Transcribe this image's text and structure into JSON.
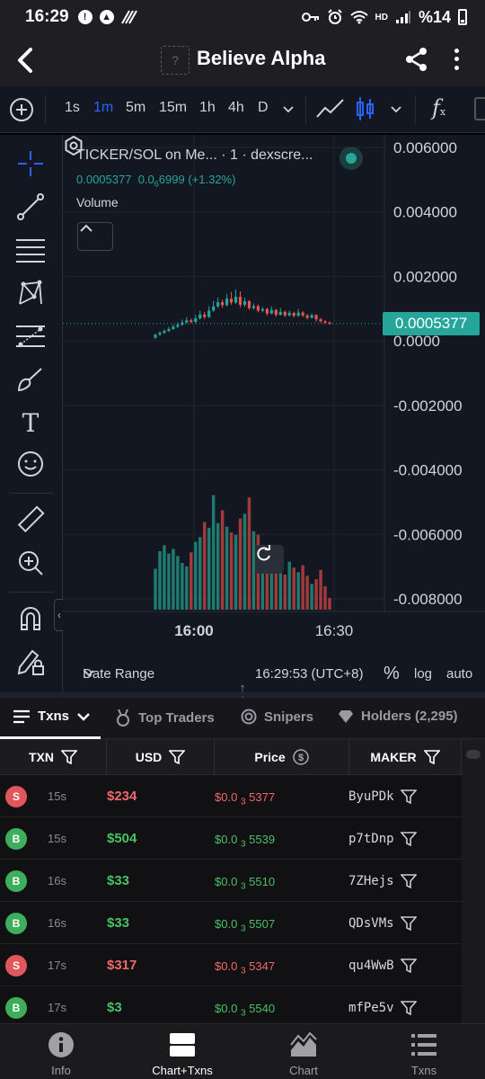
{
  "status_bar": {
    "time": "16:29",
    "network": "HD",
    "battery": "%14"
  },
  "header": {
    "title": "Believe Alpha",
    "logo_placeholder": "?"
  },
  "toolbar": {
    "intervals": [
      {
        "label": "1s",
        "active": false
      },
      {
        "label": "1m",
        "active": true
      },
      {
        "label": "5m",
        "active": false
      },
      {
        "label": "15m",
        "active": false
      },
      {
        "label": "1h",
        "active": false
      },
      {
        "label": "4h",
        "active": false
      },
      {
        "label": "D",
        "active": false
      }
    ],
    "fx_label": "f",
    "fx_sub": "x"
  },
  "drawing_tools": [
    "crosshair-icon",
    "trend-line-icon",
    "horizontal-lines-icon",
    "pattern-icon",
    "fib-icon",
    "brush-icon",
    "text-icon",
    "emoji-icon",
    "ruler-icon",
    "zoom-in-icon",
    "magnet-icon",
    "lock-pencil-icon"
  ],
  "chart": {
    "legend_title": "TICKER/SOL on Me... · 1 · dexscre...",
    "legend_price": "0.0005377",
    "legend_open": "0.0",
    "legend_open_sub": "6",
    "legend_open_rest": "6999",
    "legend_change": "(+1.32%)",
    "volume_label": "Volume",
    "last_price": "0.0005377",
    "date_range_label": "Date Range",
    "clock": "16:29:53 (UTC+8)",
    "percent_label": "%",
    "log_label": "log",
    "auto_label": "auto"
  },
  "chart_data": {
    "type": "candlestick",
    "interval": "1m",
    "y_ticks": [
      "0.006000",
      "0.004000",
      "0.002000",
      "0.0000",
      "-0.002000",
      "-0.004000",
      "-0.006000",
      "-0.008000"
    ],
    "x_ticks": [
      "16:00",
      "16:30"
    ],
    "ylim": [
      -0.0085,
      0.0065
    ],
    "last_price": 0.0005377,
    "candles": [
      {
        "o": 0.0001,
        "c": 0.00019,
        "h": 0.00023,
        "l": 7e-05
      },
      {
        "o": 0.00019,
        "c": 0.00025,
        "h": 0.0003,
        "l": 0.00016
      },
      {
        "o": 0.00025,
        "c": 0.00031,
        "h": 0.00036,
        "l": 0.00022
      },
      {
        "o": 0.00031,
        "c": 0.00037,
        "h": 0.00043,
        "l": 0.00027
      },
      {
        "o": 0.00037,
        "c": 0.00044,
        "h": 0.00051,
        "l": 0.00034
      },
      {
        "o": 0.00044,
        "c": 0.0005,
        "h": 0.00058,
        "l": 0.0004
      },
      {
        "o": 0.0005,
        "c": 0.00057,
        "h": 0.00066,
        "l": 0.00047
      },
      {
        "o": 0.00057,
        "c": 0.00064,
        "h": 0.00074,
        "l": 0.00053
      },
      {
        "o": 0.00064,
        "c": 0.00059,
        "h": 0.0007,
        "l": 0.00054
      },
      {
        "o": 0.00059,
        "c": 0.0007,
        "h": 0.00081,
        "l": 0.00055
      },
      {
        "o": 0.0007,
        "c": 0.00082,
        "h": 0.00094,
        "l": 0.00066
      },
      {
        "o": 0.00082,
        "c": 0.00074,
        "h": 0.0009,
        "l": 0.00068
      },
      {
        "o": 0.00074,
        "c": 0.00094,
        "h": 0.00108,
        "l": 0.00071
      },
      {
        "o": 0.00094,
        "c": 0.00107,
        "h": 0.00124,
        "l": 0.0009
      },
      {
        "o": 0.00107,
        "c": 0.0012,
        "h": 0.00135,
        "l": 0.00102
      },
      {
        "o": 0.0012,
        "c": 0.00111,
        "h": 0.00128,
        "l": 0.00103
      },
      {
        "o": 0.00111,
        "c": 0.00131,
        "h": 0.00146,
        "l": 0.00107
      },
      {
        "o": 0.00131,
        "c": 0.00119,
        "h": 0.00152,
        "l": 0.00112
      },
      {
        "o": 0.00119,
        "c": 0.00137,
        "h": 0.0016,
        "l": 0.00115
      },
      {
        "o": 0.00137,
        "c": 0.00112,
        "h": 0.00154,
        "l": 0.00104
      },
      {
        "o": 0.00112,
        "c": 0.00123,
        "h": 0.00134,
        "l": 0.00106
      },
      {
        "o": 0.00123,
        "c": 0.00102,
        "h": 0.00127,
        "l": 0.00096
      },
      {
        "o": 0.00102,
        "c": 0.00108,
        "h": 0.00116,
        "l": 0.00097
      },
      {
        "o": 0.00108,
        "c": 0.00094,
        "h": 0.00113,
        "l": 0.00089
      },
      {
        "o": 0.00094,
        "c": 0.00099,
        "h": 0.00105,
        "l": 0.00089
      },
      {
        "o": 0.00099,
        "c": 0.00085,
        "h": 0.00103,
        "l": 0.00078
      },
      {
        "o": 0.00085,
        "c": 0.00096,
        "h": 0.00107,
        "l": 0.00082
      },
      {
        "o": 0.00096,
        "c": 0.00081,
        "h": 0.001,
        "l": 0.00075
      },
      {
        "o": 0.00081,
        "c": 0.0009,
        "h": 0.00102,
        "l": 0.00078
      },
      {
        "o": 0.0009,
        "c": 0.00079,
        "h": 0.00095,
        "l": 0.00074
      },
      {
        "o": 0.00079,
        "c": 0.00087,
        "h": 0.00094,
        "l": 0.00076
      },
      {
        "o": 0.00087,
        "c": 0.00078,
        "h": 0.00091,
        "l": 0.00073
      },
      {
        "o": 0.00078,
        "c": 0.00088,
        "h": 0.00099,
        "l": 0.00075
      },
      {
        "o": 0.00088,
        "c": 0.00079,
        "h": 0.00092,
        "l": 0.00074
      },
      {
        "o": 0.00079,
        "c": 0.00072,
        "h": 0.00084,
        "l": 0.00067
      },
      {
        "o": 0.00072,
        "c": 0.0008,
        "h": 0.00085,
        "l": 0.00069
      },
      {
        "o": 0.0008,
        "c": 0.00067,
        "h": 0.00083,
        "l": 0.0006
      },
      {
        "o": 0.00067,
        "c": 0.00061,
        "h": 0.00072,
        "l": 0.00056
      },
      {
        "o": 0.00061,
        "c": 0.00057,
        "h": 0.00064,
        "l": 0.00052
      },
      {
        "o": 0.00057,
        "c": 0.00054,
        "h": 0.0006,
        "l": 0.0005
      }
    ],
    "volume": [
      0.35,
      0.5,
      0.55,
      0.48,
      0.52,
      0.46,
      0.4,
      0.37,
      0.49,
      0.58,
      0.62,
      0.75,
      0.7,
      0.98,
      0.74,
      0.85,
      0.71,
      0.66,
      0.64,
      0.78,
      0.82,
      0.96,
      0.67,
      0.64,
      0.48,
      0.44,
      0.47,
      0.36,
      0.38,
      0.3,
      0.41,
      0.36,
      0.32,
      0.38,
      0.29,
      0.22,
      0.26,
      0.34,
      0.2,
      0.1
    ]
  },
  "tabs": [
    {
      "label": "Txns",
      "icon": "list-icon",
      "active": true
    },
    {
      "label": "Top Traders",
      "icon": "medal-icon",
      "active": false
    },
    {
      "label": "Snipers",
      "icon": "target-icon",
      "active": false
    },
    {
      "label": "Holders (2,295)",
      "icon": "diamond-icon",
      "active": false
    }
  ],
  "table": {
    "headers": [
      "TXN",
      "USD",
      "Price",
      "MAKER"
    ],
    "rows": [
      {
        "type": "S",
        "age": "15s",
        "usd": "$234",
        "price_prefix": "$0.0",
        "price_sub": "3",
        "price_digits": "5377",
        "maker": "ByuPDk"
      },
      {
        "type": "B",
        "age": "15s",
        "usd": "$504",
        "price_prefix": "$0.0",
        "price_sub": "3",
        "price_digits": "5539",
        "maker": "p7tDnp"
      },
      {
        "type": "B",
        "age": "16s",
        "usd": "$33",
        "price_prefix": "$0.0",
        "price_sub": "3",
        "price_digits": "5510",
        "maker": "7ZHejs"
      },
      {
        "type": "B",
        "age": "16s",
        "usd": "$33",
        "price_prefix": "$0.0",
        "price_sub": "3",
        "price_digits": "5507",
        "maker": "QDsVMs"
      },
      {
        "type": "S",
        "age": "17s",
        "usd": "$317",
        "price_prefix": "$0.0",
        "price_sub": "3",
        "price_digits": "5347",
        "maker": "qu4WwB"
      },
      {
        "type": "B",
        "age": "17s",
        "usd": "$3",
        "price_prefix": "$0.0",
        "price_sub": "3",
        "price_digits": "5540",
        "maker": "mfPe5v"
      }
    ]
  },
  "bottom_nav": [
    {
      "label": "Info",
      "icon": "info-icon",
      "active": false
    },
    {
      "label": "Chart+Txns",
      "icon": "split-view-icon",
      "active": true
    },
    {
      "label": "Chart",
      "icon": "area-chart-icon",
      "active": false
    },
    {
      "label": "Txns",
      "icon": "list-icon",
      "active": false
    }
  ],
  "colors": {
    "up": "#26a69a",
    "down": "#ef5350",
    "buy": "#49c165",
    "sell": "#f0686d",
    "active_interval": "#2962ff"
  }
}
